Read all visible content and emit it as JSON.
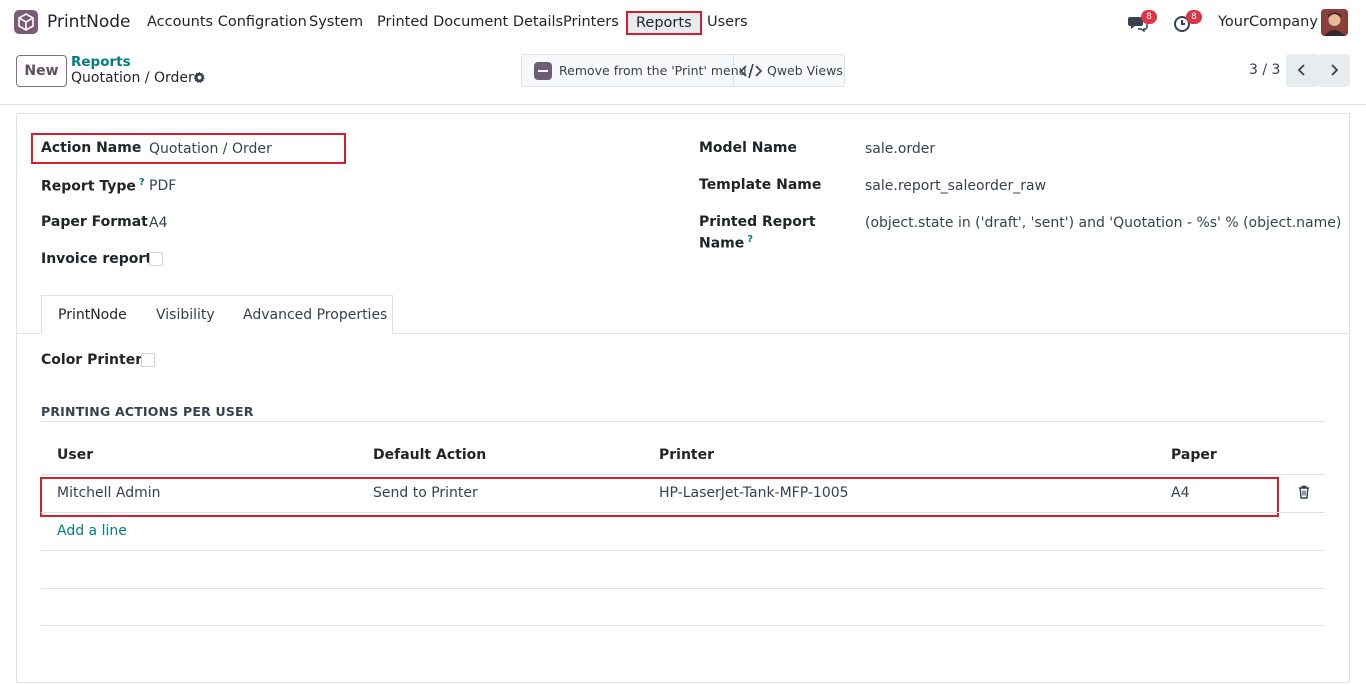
{
  "app": {
    "name": "PrintNode",
    "menu": [
      "Accounts Configration",
      "System",
      "Printed Document Details",
      "Printers",
      "Reports",
      "Users"
    ],
    "active_menu": "Reports",
    "messages_count": "8",
    "activities_count": "8",
    "company": "YourCompany"
  },
  "control_panel": {
    "new_label": "New",
    "breadcrumb_parent": "Reports",
    "breadcrumb_current": "Quotation / Order",
    "remove_label": "Remove from the 'Print' menu",
    "qweb_label": "Qweb Views",
    "pager": "3 / 3"
  },
  "form": {
    "left": [
      {
        "label": "Action Name",
        "value": "Quotation / Order",
        "help": false
      },
      {
        "label": "Report Type",
        "value": "PDF",
        "help": true
      },
      {
        "label": "Paper Format",
        "value": "A4",
        "help": false
      },
      {
        "label": "Invoice report",
        "value": "",
        "help": false
      }
    ],
    "right": [
      {
        "label": "Model Name",
        "value": "sale.order"
      },
      {
        "label": "Template Name",
        "value": "sale.report_saleorder_raw"
      },
      {
        "label_line1": "Printed Report",
        "label_line2": "Name",
        "value": "(object.state in ('draft', 'sent') and 'Quotation - %s' % (object.name)"
      }
    ],
    "help_mark": "?"
  },
  "tabs": [
    "PrintNode",
    "Visibility",
    "Advanced Properties"
  ],
  "printnode_tab": {
    "color_printer_label": "Color Printer",
    "section_title": "PRINTING ACTIONS PER USER",
    "columns": [
      "User",
      "Default Action",
      "Printer",
      "Paper"
    ],
    "rows": [
      {
        "user": "Mitchell Admin",
        "action": "Send to Printer",
        "printer": "HP-LaserJet-Tank-MFP-1005",
        "paper": "A4"
      }
    ],
    "add_line": "Add a line"
  },
  "colors": {
    "highlight": "#d4202c",
    "brand": "#7b5a78",
    "link": "#017e84"
  }
}
